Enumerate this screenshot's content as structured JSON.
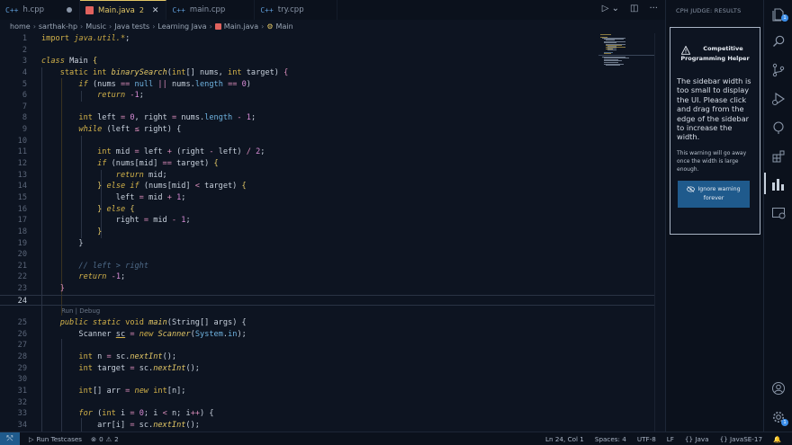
{
  "tabs": [
    {
      "icon": "C++",
      "label": "h.cpp",
      "active": false,
      "modified": true
    },
    {
      "icon": "java",
      "label": "Main.java",
      "badge": "2",
      "active": true
    },
    {
      "icon": "C++",
      "label": "main.cpp",
      "active": false
    },
    {
      "icon": "C++",
      "label": "try.cpp",
      "active": false
    }
  ],
  "breadcrumb": [
    "home",
    "sarthak-hp",
    "Music",
    "Java tests",
    "Learning Java",
    "Main.java",
    "Main"
  ],
  "cph": {
    "panel_title": "CPH JUDGE: RESULTS",
    "heading_line1": "Competitive",
    "heading_line2": "Programming Helper",
    "message": "The sidebar width is too small to display the UI. Please click and drag from the edge of the sidebar to increase the width.",
    "sub": "This warning will go away once the width is large enough.",
    "button_line1": "Ignore warning",
    "button_line2": "forever"
  },
  "codelens": "Run | Debug",
  "status": {
    "run_testcases": "Run Testcases",
    "errors": "0",
    "warnings": "2",
    "position": "Ln 24, Col 1",
    "spaces": "Spaces: 4",
    "encoding": "UTF-8",
    "eol": "LF",
    "language": "Java",
    "runtime": "JavaSE-17"
  },
  "colors": {
    "accent": "#e3c766",
    "button": "#1f5a8c",
    "background": "#0d1421"
  }
}
